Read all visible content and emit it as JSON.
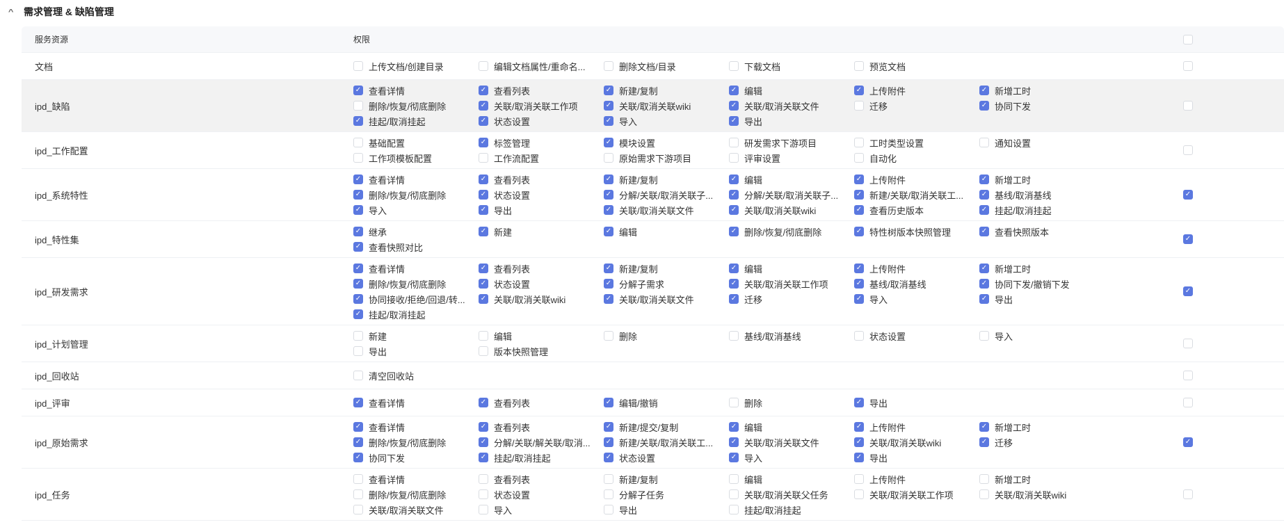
{
  "section": {
    "title": "需求管理 & 缺陷管理"
  },
  "header": {
    "resource": "服务资源",
    "permissions": "权限",
    "all_checked": false
  },
  "colors": {
    "accent": "#5b78e0"
  },
  "rows": [
    {
      "name": "文档",
      "all": false,
      "perms": [
        {
          "label": "上传文档/创建目录",
          "checked": false
        },
        {
          "label": "编辑文档属性/重命名...",
          "checked": false
        },
        {
          "label": "删除文档/目录",
          "checked": false
        },
        {
          "label": "下载文档",
          "checked": false
        },
        {
          "label": "预览文档",
          "checked": false
        }
      ]
    },
    {
      "name": "ipd_缺陷",
      "all": false,
      "highlighted": true,
      "perms": [
        {
          "label": "查看详情",
          "checked": true
        },
        {
          "label": "查看列表",
          "checked": true
        },
        {
          "label": "新建/复制",
          "checked": true
        },
        {
          "label": "编辑",
          "checked": true
        },
        {
          "label": "上传附件",
          "checked": true
        },
        {
          "label": "新增工时",
          "checked": true
        },
        {
          "label": "删除/恢复/彻底删除",
          "checked": false
        },
        {
          "label": "关联/取消关联工作项",
          "checked": true
        },
        {
          "label": "关联/取消关联wiki",
          "checked": true
        },
        {
          "label": "关联/取消关联文件",
          "checked": true
        },
        {
          "label": "迁移",
          "checked": false
        },
        {
          "label": "协同下发",
          "checked": true
        },
        {
          "label": "挂起/取消挂起",
          "checked": true
        },
        {
          "label": "状态设置",
          "checked": true
        },
        {
          "label": "导入",
          "checked": true
        },
        {
          "label": "导出",
          "checked": true
        }
      ]
    },
    {
      "name": "ipd_工作配置",
      "all": false,
      "perms": [
        {
          "label": "基础配置",
          "checked": false
        },
        {
          "label": "标签管理",
          "checked": true
        },
        {
          "label": "模块设置",
          "checked": true
        },
        {
          "label": "研发需求下游项目",
          "checked": false
        },
        {
          "label": "工时类型设置",
          "checked": false
        },
        {
          "label": "通知设置",
          "checked": false
        },
        {
          "label": "工作项模板配置",
          "checked": false
        },
        {
          "label": "工作流配置",
          "checked": false
        },
        {
          "label": "原始需求下游项目",
          "checked": false
        },
        {
          "label": "评审设置",
          "checked": false
        },
        {
          "label": "自动化",
          "checked": false
        }
      ]
    },
    {
      "name": "ipd_系统特性",
      "all": true,
      "perms": [
        {
          "label": "查看详情",
          "checked": true
        },
        {
          "label": "查看列表",
          "checked": true
        },
        {
          "label": "新建/复制",
          "checked": true
        },
        {
          "label": "编辑",
          "checked": true
        },
        {
          "label": "上传附件",
          "checked": true
        },
        {
          "label": "新增工时",
          "checked": true
        },
        {
          "label": "删除/恢复/彻底删除",
          "checked": true
        },
        {
          "label": "状态设置",
          "checked": true
        },
        {
          "label": "分解/关联/取消关联子...",
          "checked": true
        },
        {
          "label": "分解/关联/取消关联子...",
          "checked": true
        },
        {
          "label": "新建/关联/取消关联工...",
          "checked": true
        },
        {
          "label": "基线/取消基线",
          "checked": true
        },
        {
          "label": "导入",
          "checked": true
        },
        {
          "label": "导出",
          "checked": true
        },
        {
          "label": "关联/取消关联文件",
          "checked": true
        },
        {
          "label": "关联/取消关联wiki",
          "checked": true
        },
        {
          "label": "查看历史版本",
          "checked": true
        },
        {
          "label": "挂起/取消挂起",
          "checked": true
        }
      ]
    },
    {
      "name": "ipd_特性集",
      "all": true,
      "perms": [
        {
          "label": "继承",
          "checked": true
        },
        {
          "label": "新建",
          "checked": true
        },
        {
          "label": "编辑",
          "checked": true
        },
        {
          "label": "删除/恢复/彻底删除",
          "checked": true
        },
        {
          "label": "特性树版本快照管理",
          "checked": true
        },
        {
          "label": "查看快照版本",
          "checked": true
        },
        {
          "label": "查看快照对比",
          "checked": true
        }
      ]
    },
    {
      "name": "ipd_研发需求",
      "all": true,
      "perms": [
        {
          "label": "查看详情",
          "checked": true
        },
        {
          "label": "查看列表",
          "checked": true
        },
        {
          "label": "新建/复制",
          "checked": true
        },
        {
          "label": "编辑",
          "checked": true
        },
        {
          "label": "上传附件",
          "checked": true
        },
        {
          "label": "新增工时",
          "checked": true
        },
        {
          "label": "删除/恢复/彻底删除",
          "checked": true
        },
        {
          "label": "状态设置",
          "checked": true
        },
        {
          "label": "分解子需求",
          "checked": true
        },
        {
          "label": "关联/取消关联工作项",
          "checked": true
        },
        {
          "label": "基线/取消基线",
          "checked": true
        },
        {
          "label": "协同下发/撤销下发",
          "checked": true
        },
        {
          "label": "协同接收/拒绝/回退/转...",
          "checked": true
        },
        {
          "label": "关联/取消关联wiki",
          "checked": true
        },
        {
          "label": "关联/取消关联文件",
          "checked": true
        },
        {
          "label": "迁移",
          "checked": true
        },
        {
          "label": "导入",
          "checked": true
        },
        {
          "label": "导出",
          "checked": true
        },
        {
          "label": "挂起/取消挂起",
          "checked": true
        }
      ]
    },
    {
      "name": "ipd_计划管理",
      "all": false,
      "perms": [
        {
          "label": "新建",
          "checked": false
        },
        {
          "label": "编辑",
          "checked": false
        },
        {
          "label": "删除",
          "checked": false
        },
        {
          "label": "基线/取消基线",
          "checked": false
        },
        {
          "label": "状态设置",
          "checked": false
        },
        {
          "label": "导入",
          "checked": false
        },
        {
          "label": "导出",
          "checked": false
        },
        {
          "label": "版本快照管理",
          "checked": false
        }
      ]
    },
    {
      "name": "ipd_回收站",
      "all": false,
      "perms": [
        {
          "label": "清空回收站",
          "checked": false
        }
      ]
    },
    {
      "name": "ipd_评审",
      "all": false,
      "perms": [
        {
          "label": "查看详情",
          "checked": true
        },
        {
          "label": "查看列表",
          "checked": true
        },
        {
          "label": "编辑/撤销",
          "checked": true
        },
        {
          "label": "删除",
          "checked": false
        },
        {
          "label": "导出",
          "checked": true
        }
      ]
    },
    {
      "name": "ipd_原始需求",
      "all": true,
      "perms": [
        {
          "label": "查看详情",
          "checked": true
        },
        {
          "label": "查看列表",
          "checked": true
        },
        {
          "label": "新建/提交/复制",
          "checked": true
        },
        {
          "label": "编辑",
          "checked": true
        },
        {
          "label": "上传附件",
          "checked": true
        },
        {
          "label": "新增工时",
          "checked": true
        },
        {
          "label": "删除/恢复/彻底删除",
          "checked": true
        },
        {
          "label": "分解/关联/解关联/取消...",
          "checked": true
        },
        {
          "label": "新建/关联/取消关联工...",
          "checked": true
        },
        {
          "label": "关联/取消关联文件",
          "checked": true
        },
        {
          "label": "关联/取消关联wiki",
          "checked": true
        },
        {
          "label": "迁移",
          "checked": true
        },
        {
          "label": "协同下发",
          "checked": true
        },
        {
          "label": "挂起/取消挂起",
          "checked": true
        },
        {
          "label": "状态设置",
          "checked": true
        },
        {
          "label": "导入",
          "checked": true
        },
        {
          "label": "导出",
          "checked": true
        }
      ]
    },
    {
      "name": "ipd_任务",
      "all": false,
      "perms": [
        {
          "label": "查看详情",
          "checked": false
        },
        {
          "label": "查看列表",
          "checked": false
        },
        {
          "label": "新建/复制",
          "checked": false
        },
        {
          "label": "编辑",
          "checked": false
        },
        {
          "label": "上传附件",
          "checked": false
        },
        {
          "label": "新增工时",
          "checked": false
        },
        {
          "label": "删除/恢复/彻底删除",
          "checked": false
        },
        {
          "label": "状态设置",
          "checked": false
        },
        {
          "label": "分解子任务",
          "checked": false
        },
        {
          "label": "关联/取消关联父任务",
          "checked": false
        },
        {
          "label": "关联/取消关联工作项",
          "checked": false
        },
        {
          "label": "关联/取消关联wiki",
          "checked": false
        },
        {
          "label": "关联/取消关联文件",
          "checked": false
        },
        {
          "label": "导入",
          "checked": false
        },
        {
          "label": "导出",
          "checked": false
        },
        {
          "label": "挂起/取消挂起",
          "checked": false
        }
      ]
    }
  ]
}
